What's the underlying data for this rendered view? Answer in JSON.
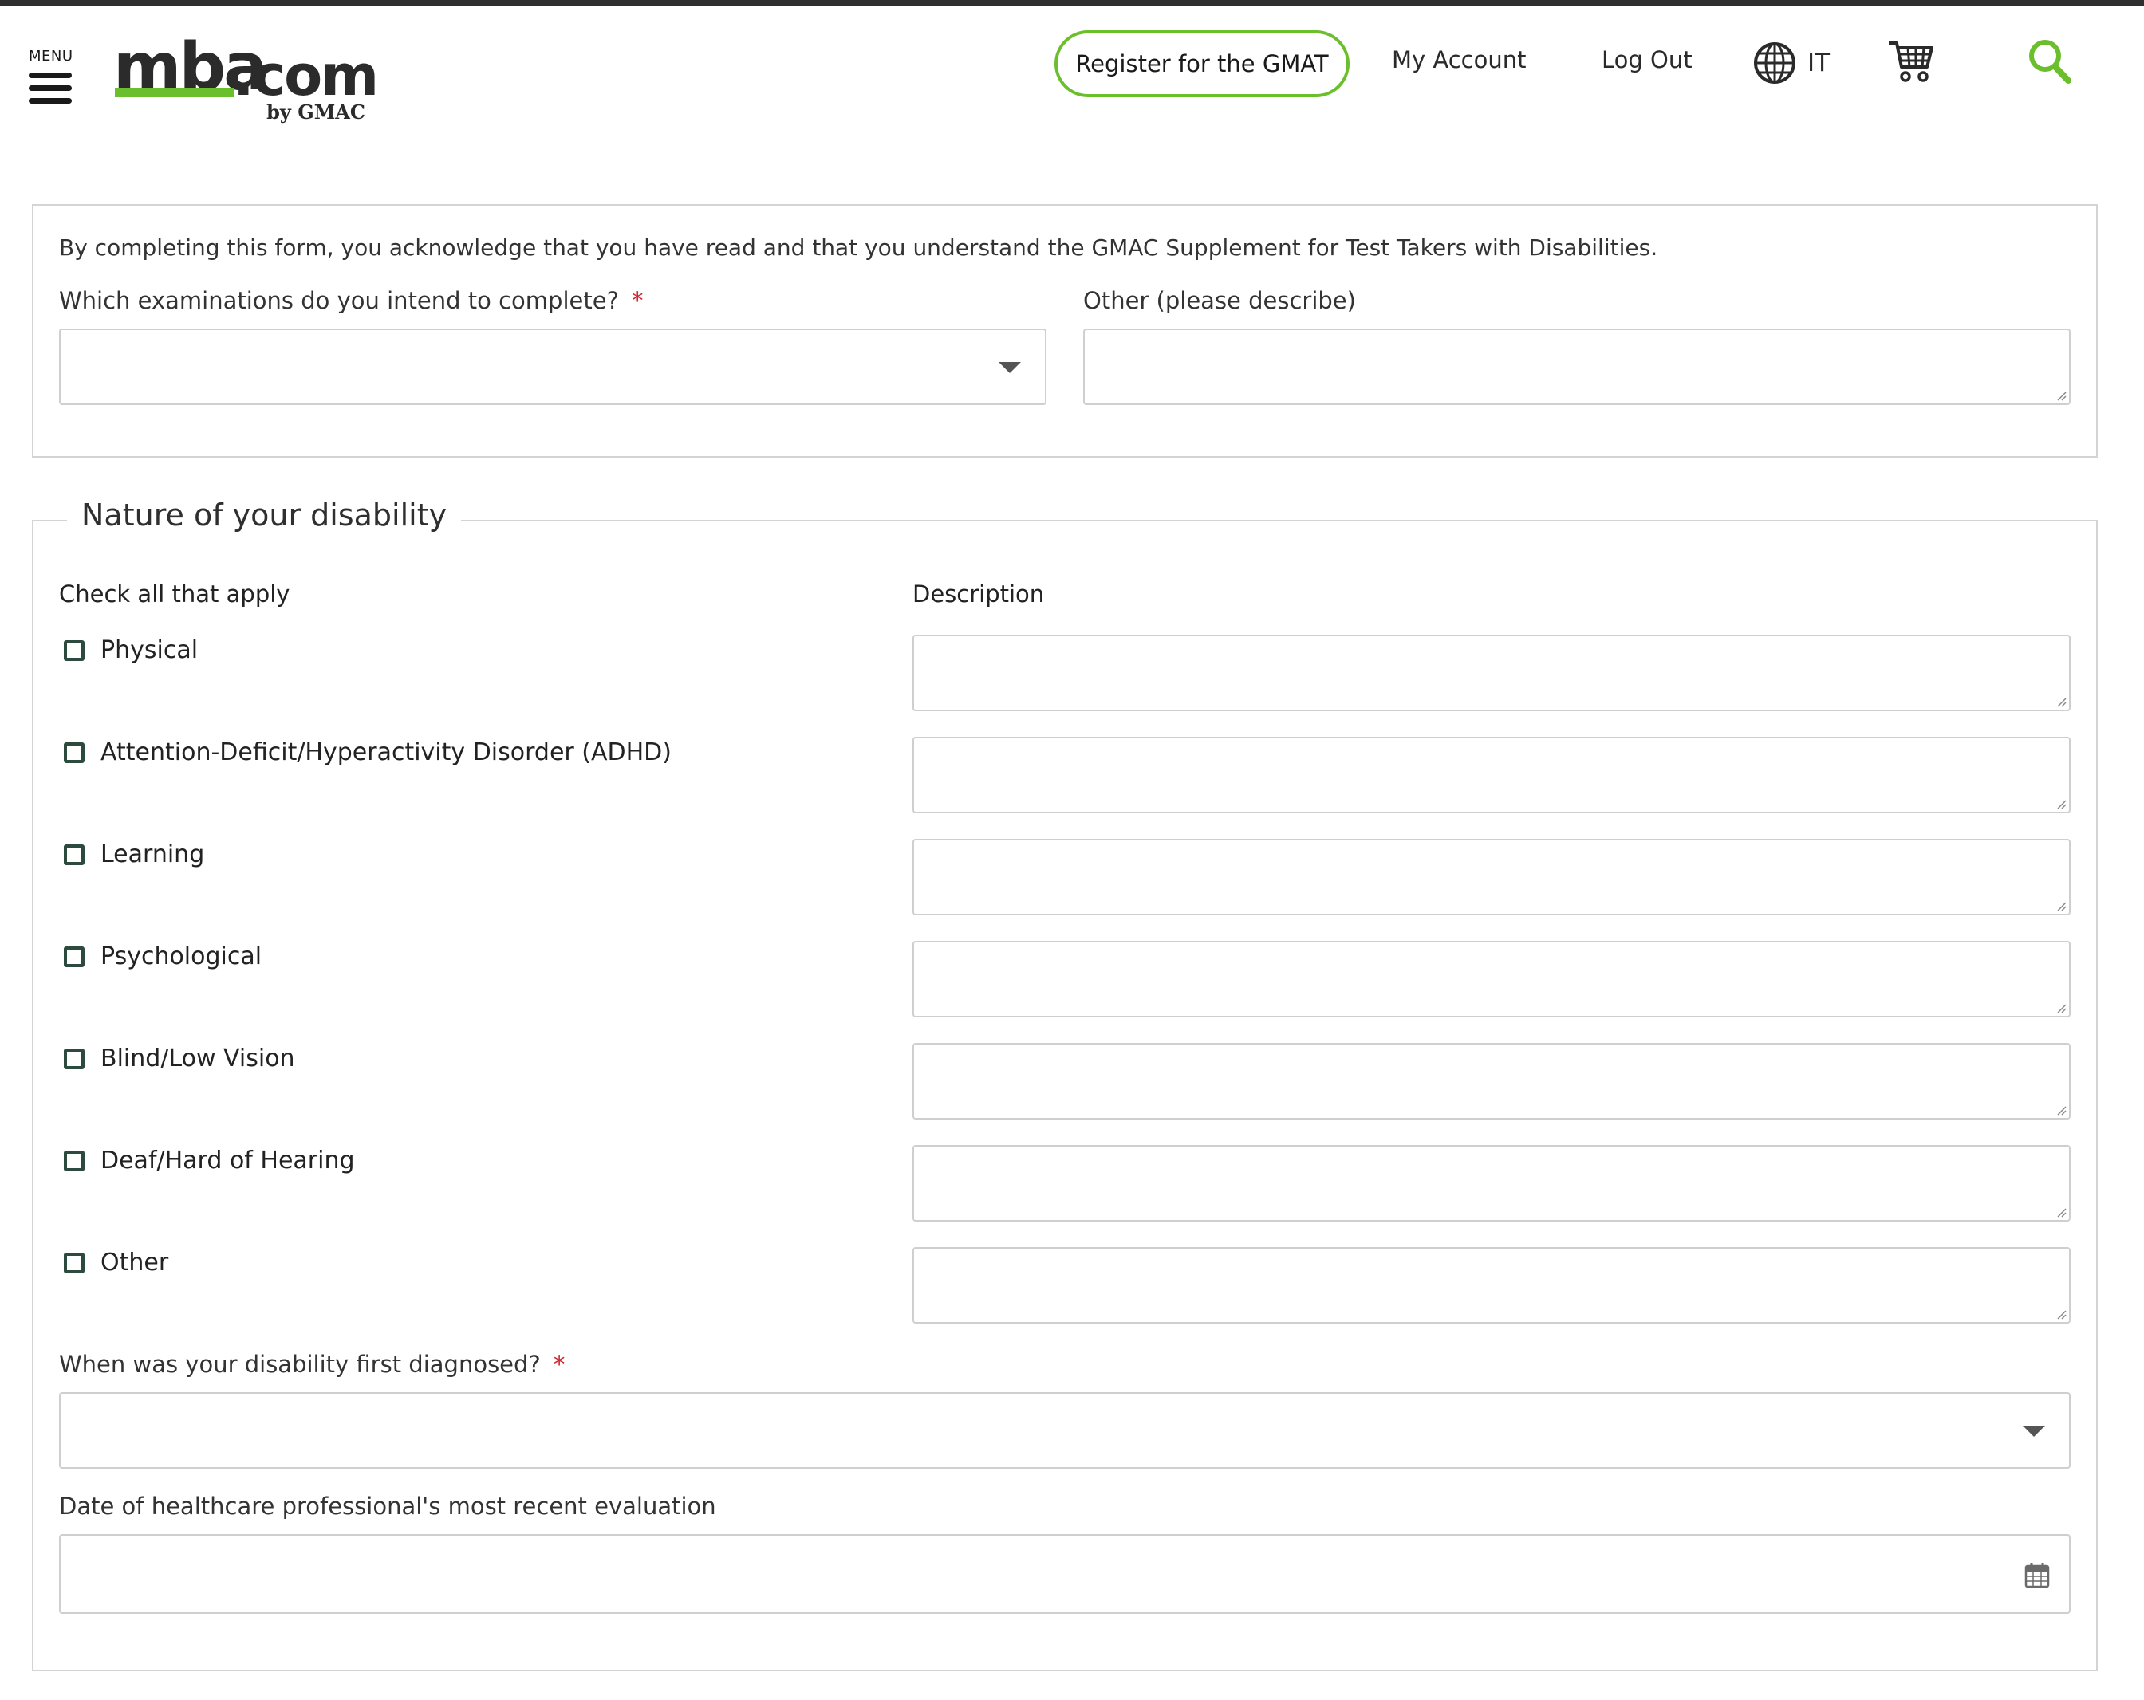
{
  "header": {
    "menu_label": "MENU",
    "logo": {
      "main": "mba",
      "suffix": ".com",
      "by": "by GMAC"
    },
    "register_button": "Register for the GMAT",
    "my_account": "My Account",
    "log_out": "Log Out",
    "language": "IT",
    "colors": {
      "brand_green": "#6bbf2c",
      "required_red": "#d0262e"
    }
  },
  "exam_section": {
    "acknowledgement": "By completing this form, you acknowledge that you have read and that you understand the GMAC Supplement for Test Takers with Disabilities.",
    "exams_label": "Which examinations do you intend to complete?",
    "exams_required": "*",
    "exams_value": "",
    "other_label": "Other (please describe)",
    "other_value": ""
  },
  "disability_section": {
    "legend": "Nature of your disability",
    "check_heading": "Check all that apply",
    "description_heading": "Description",
    "options": [
      {
        "label": "Physical",
        "checked": false,
        "description": ""
      },
      {
        "label": "Attention-Deficit/Hyperactivity Disorder (ADHD)",
        "checked": false,
        "description": ""
      },
      {
        "label": "Learning",
        "checked": false,
        "description": ""
      },
      {
        "label": "Psychological",
        "checked": false,
        "description": ""
      },
      {
        "label": "Blind/Low Vision",
        "checked": false,
        "description": ""
      },
      {
        "label": "Deaf/Hard of Hearing",
        "checked": false,
        "description": ""
      },
      {
        "label": "Other",
        "checked": false,
        "description": ""
      }
    ],
    "diagnosed_label": "When was your disability first diagnosed?",
    "diagnosed_required": "*",
    "diagnosed_value": "",
    "evaluation_label": "Date of healthcare professional's most recent evaluation",
    "evaluation_value": ""
  },
  "icons": [
    "menu-icon",
    "globe-icon",
    "cart-icon",
    "search-icon",
    "caret-down-icon",
    "calendar-icon",
    "resize-grip-icon"
  ]
}
